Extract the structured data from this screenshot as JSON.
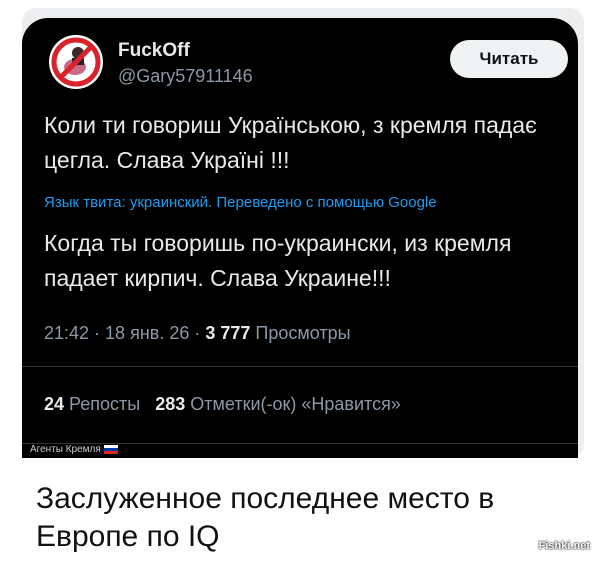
{
  "tweet": {
    "display_name": "FuckOff",
    "handle": "@Gary57911146",
    "follow_label": "Читать",
    "text": "Коли ти говориш Українською, з кремля падає цегла. Слава Україні !!!",
    "translation_note": "Язык твита: украинский. Переведено с помощью Google",
    "translated_text": "Когда ты говоришь по-украински, из кремля падает кирпич. Слава Украине!!!",
    "time": "21:42",
    "date": "18 янв. 26",
    "views_count": "3 777",
    "views_label": "Просмотры",
    "reposts_count": "24",
    "reposts_label": "Репосты",
    "likes_count": "283",
    "likes_label": "Отметки(-ок) «Нравится»"
  },
  "overlay_tag": "Агенты Кремля",
  "caption": "Заслуженное последнее место в Европе по IQ",
  "watermark": "Fishki.net"
}
